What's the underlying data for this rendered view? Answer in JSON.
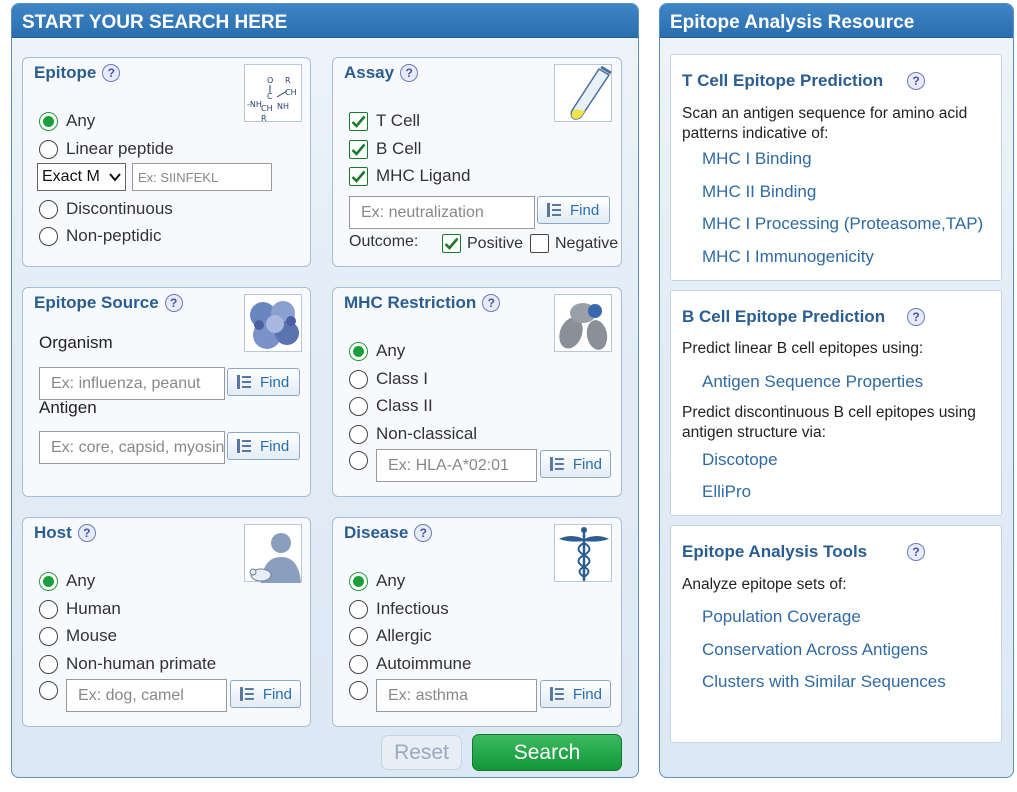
{
  "search_panel": {
    "title": "START YOUR SEARCH HERE",
    "epitope": {
      "title": "Epitope",
      "help": "?",
      "options": [
        "Any",
        "Linear peptide",
        "Discontinuous",
        "Non-peptidic"
      ],
      "match_select": "Exact M",
      "peptide_placeholder": "Ex: SIINFEKL"
    },
    "assay": {
      "title": "Assay",
      "help": "?",
      "checks": [
        "T Cell",
        "B Cell",
        "MHC Ligand"
      ],
      "search_placeholder": "Ex: neutralization",
      "find_label": "Find",
      "outcome_label": "Outcome:",
      "positive_label": "Positive",
      "negative_label": "Negative"
    },
    "epitope_source": {
      "title": "Epitope Source",
      "help": "?",
      "organism_label": "Organism",
      "organism_placeholder": "Ex: influenza, peanut",
      "antigen_label": "Antigen",
      "antigen_placeholder": "Ex: core, capsid, myosin",
      "find_label": "Find"
    },
    "mhc_restriction": {
      "title": "MHC Restriction",
      "help": "?",
      "options": [
        "Any",
        "Class I",
        "Class II",
        "Non-classical"
      ],
      "allele_placeholder": "Ex: HLA-A*02:01",
      "find_label": "Find"
    },
    "host": {
      "title": "Host",
      "help": "?",
      "options": [
        "Any",
        "Human",
        "Mouse",
        "Non-human primate"
      ],
      "other_placeholder": "Ex: dog, camel",
      "find_label": "Find"
    },
    "disease": {
      "title": "Disease",
      "help": "?",
      "options": [
        "Any",
        "Infectious",
        "Allergic",
        "Autoimmune"
      ],
      "other_placeholder": "Ex: asthma",
      "find_label": "Find"
    },
    "reset_label": "Reset",
    "search_label": "Search"
  },
  "resource_panel": {
    "title": "Epitope Analysis Resource",
    "tcell": {
      "title": "T Cell Epitope Prediction",
      "help": "?",
      "desc": "Scan an antigen sequence for amino acid patterns indicative of:",
      "links": [
        "MHC I Binding",
        "MHC II Binding",
        "MHC I Processing (Proteasome,TAP)",
        "MHC I Immunogenicity"
      ]
    },
    "bcell": {
      "title": "B Cell Epitope Prediction",
      "help": "?",
      "desc1": "Predict linear B cell epitopes using:",
      "link1": "Antigen Sequence Properties",
      "desc2": "Predict discontinuous B cell epitopes using antigen structure via:",
      "links2": [
        "Discotope",
        "ElliPro"
      ]
    },
    "tools": {
      "title": "Epitope Analysis Tools",
      "help": "?",
      "desc": "Analyze epitope sets of:",
      "links": [
        "Population Coverage",
        "Conservation Across Antigens",
        "Clusters with Similar Sequences"
      ]
    }
  },
  "colors": {
    "header_blue": "#2a6eae",
    "title_blue": "#2a5d90",
    "link_blue": "#2f6aa3",
    "radio_green": "#1e9e3a",
    "search_green": "#1e9e3a"
  },
  "icons": [
    "help-icon",
    "chemical-structure-icon",
    "pipette-icon",
    "protein-structure-icon",
    "mhc-molecule-icon",
    "human-host-icon",
    "caduceus-icon",
    "find-list-icon",
    "checkmark-icon"
  ]
}
